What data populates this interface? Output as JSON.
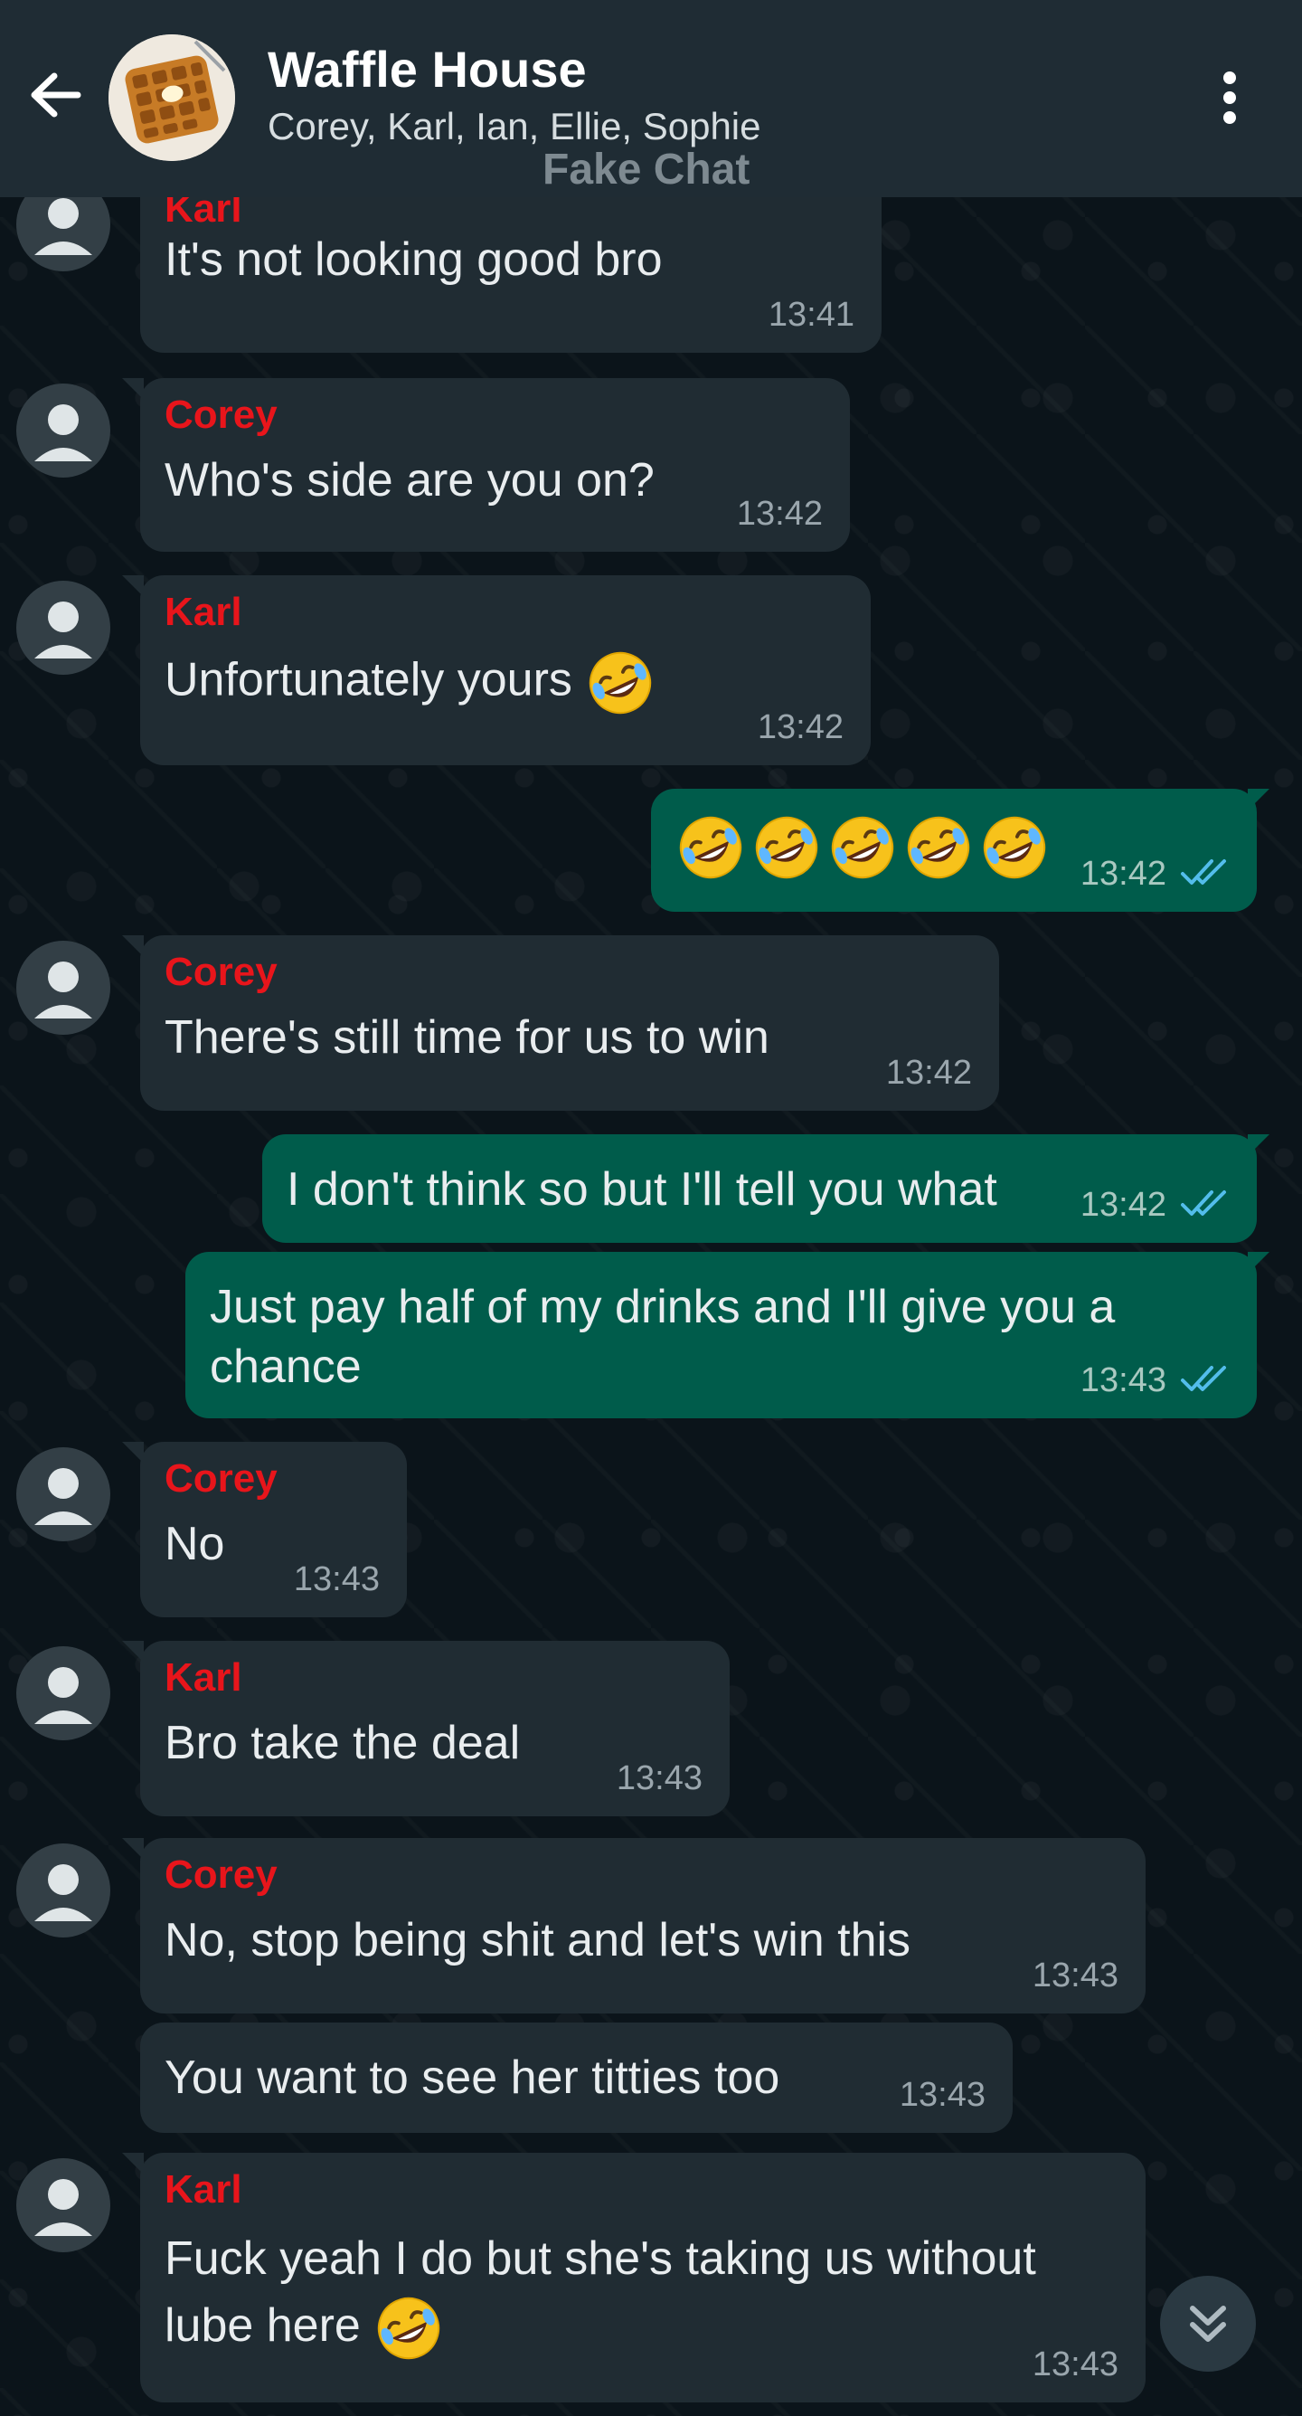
{
  "header": {
    "title": "Waffle House",
    "members": "Corey, Karl, Ian, Ellie, Sophie",
    "watermark": "Fake Chat"
  },
  "messages": [
    {
      "dir": "in",
      "sender": "Karl",
      "text": "It's not looking good bro",
      "time": "13:41"
    },
    {
      "dir": "in",
      "sender": "Corey",
      "text": "Who's side are you on?",
      "time": "13:42"
    },
    {
      "dir": "in",
      "sender": "Karl",
      "text": "Unfortunately yours",
      "emoji_after": 1,
      "time": "13:42"
    },
    {
      "dir": "out",
      "text": "",
      "emoji_count": 5,
      "time": "13:42",
      "status": "read"
    },
    {
      "dir": "in",
      "sender": "Corey",
      "text": "There's still time for us to win",
      "time": "13:42"
    },
    {
      "dir": "out",
      "text": "I don't think so but I'll tell you what",
      "time": "13:42",
      "status": "read"
    },
    {
      "dir": "out",
      "text": "Just pay half of my drinks and I'll give you a chance",
      "time": "13:43",
      "status": "read"
    },
    {
      "dir": "in",
      "sender": "Corey",
      "text": "No",
      "time": "13:43"
    },
    {
      "dir": "in",
      "sender": "Karl",
      "text": "Bro take the deal",
      "time": "13:43"
    },
    {
      "dir": "in",
      "sender": "Corey",
      "text": "No, stop being shit and let's win this",
      "time": "13:43"
    },
    {
      "dir": "in",
      "text": "You want to see her titties too",
      "time": "13:43"
    },
    {
      "dir": "in",
      "sender": "Karl",
      "text": "Fuck yeah I do but she's taking us without lube here",
      "emoji_after": 1,
      "time": "13:43"
    }
  ],
  "colors": {
    "header_bg": "#1f2c34",
    "incoming_bubble": "#202c33",
    "outgoing_bubble": "#005c4b",
    "sender_name": "#e8151b",
    "read_ticks": "#53bdeb"
  },
  "icons": {
    "back": "arrow-left-icon",
    "menu": "more-vertical-icon",
    "scroll": "double-chevron-down-icon",
    "user": "person-icon",
    "emoji": "rolling-on-floor-laughing-emoji"
  }
}
